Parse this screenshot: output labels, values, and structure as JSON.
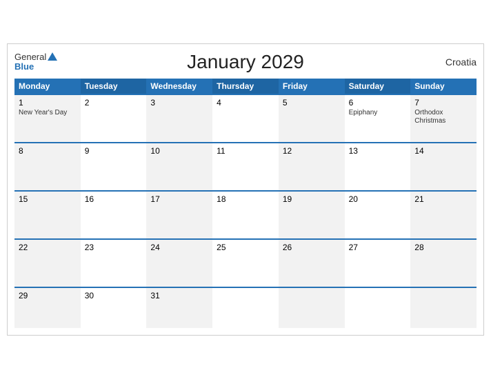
{
  "header": {
    "title": "January 2029",
    "country": "Croatia",
    "logo_general": "General",
    "logo_blue": "Blue"
  },
  "days": {
    "headers": [
      "Monday",
      "Tuesday",
      "Wednesday",
      "Thursday",
      "Friday",
      "Saturday",
      "Sunday"
    ]
  },
  "weeks": [
    {
      "cells": [
        {
          "num": "1",
          "holiday": "New Year's Day"
        },
        {
          "num": "2",
          "holiday": ""
        },
        {
          "num": "3",
          "holiday": ""
        },
        {
          "num": "4",
          "holiday": ""
        },
        {
          "num": "5",
          "holiday": ""
        },
        {
          "num": "6",
          "holiday": "Epiphany"
        },
        {
          "num": "7",
          "holiday": "Orthodox\nChristmas"
        }
      ]
    },
    {
      "cells": [
        {
          "num": "8",
          "holiday": ""
        },
        {
          "num": "9",
          "holiday": ""
        },
        {
          "num": "10",
          "holiday": ""
        },
        {
          "num": "11",
          "holiday": ""
        },
        {
          "num": "12",
          "holiday": ""
        },
        {
          "num": "13",
          "holiday": ""
        },
        {
          "num": "14",
          "holiday": ""
        }
      ]
    },
    {
      "cells": [
        {
          "num": "15",
          "holiday": ""
        },
        {
          "num": "16",
          "holiday": ""
        },
        {
          "num": "17",
          "holiday": ""
        },
        {
          "num": "18",
          "holiday": ""
        },
        {
          "num": "19",
          "holiday": ""
        },
        {
          "num": "20",
          "holiday": ""
        },
        {
          "num": "21",
          "holiday": ""
        }
      ]
    },
    {
      "cells": [
        {
          "num": "22",
          "holiday": ""
        },
        {
          "num": "23",
          "holiday": ""
        },
        {
          "num": "24",
          "holiday": ""
        },
        {
          "num": "25",
          "holiday": ""
        },
        {
          "num": "26",
          "holiday": ""
        },
        {
          "num": "27",
          "holiday": ""
        },
        {
          "num": "28",
          "holiday": ""
        }
      ]
    },
    {
      "cells": [
        {
          "num": "29",
          "holiday": ""
        },
        {
          "num": "30",
          "holiday": ""
        },
        {
          "num": "31",
          "holiday": ""
        },
        {
          "num": "",
          "holiday": ""
        },
        {
          "num": "",
          "holiday": ""
        },
        {
          "num": "",
          "holiday": ""
        },
        {
          "num": "",
          "holiday": ""
        }
      ]
    }
  ]
}
